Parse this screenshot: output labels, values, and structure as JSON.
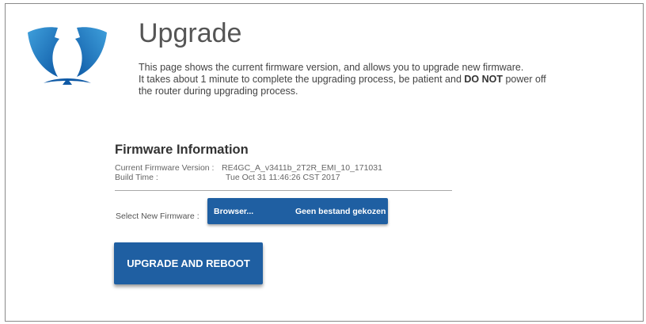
{
  "header": {
    "title": "Upgrade",
    "description_line1": "This page shows the current firmware version, and allows you to upgrade new firmware.",
    "description_line2_pre": "It takes about 1 minute to complete the upgrading process, be patient and ",
    "description_bold": "DO NOT",
    "description_line2_post": " power off",
    "description_line3": "the router during upgrading process."
  },
  "firmware_info": {
    "title": "Firmware Information",
    "version_label": "Current Firmware Version :",
    "version_value": "RE4GC_A_v3411b_2T2R_EMI_10_171031",
    "build_label": "Build Time :",
    "build_value": "Tue Oct 31 11:46:26 CST 2017"
  },
  "upload": {
    "label": "Select New Firmware :",
    "browse_label": "Browser...",
    "no_file_text": "Geen bestand gekozen"
  },
  "actions": {
    "upgrade_label": "UPGRADE AND REBOOT"
  },
  "colors": {
    "button_blue": "#1f5fa2",
    "logo_dark": "#0f5aa6",
    "logo_light": "#3fa0dc"
  },
  "icons": {
    "logo": "bird-wings-logo"
  }
}
